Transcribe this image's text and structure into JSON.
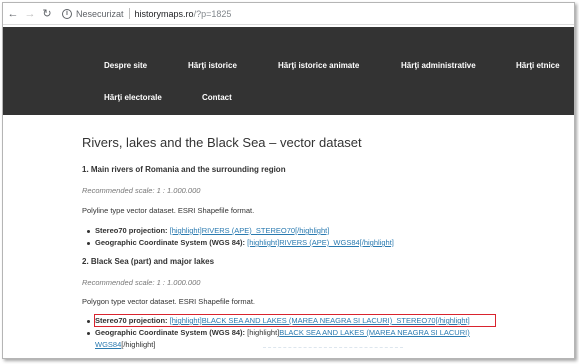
{
  "browser": {
    "back_icon": "arrow-left",
    "forward_icon": "arrow-right",
    "reload_icon": "reload",
    "security_text": "Nesecurizat",
    "url_host": "historymaps.ro",
    "url_path": "/?p=1825"
  },
  "nav": {
    "items": [
      {
        "label": "Despre site"
      },
      {
        "label": "Hărţi istorice"
      },
      {
        "label": "Hărţi istorice animate"
      },
      {
        "label": "Hărţi administrative"
      },
      {
        "label": "Hărţi etnice"
      },
      {
        "label": "Hărţi electorale"
      },
      {
        "label": "Contact"
      }
    ]
  },
  "article": {
    "title": "Rivers, lakes and the Black Sea – vector dataset",
    "sections": [
      {
        "heading": "1. Main rivers of Romania and the surrounding region",
        "scale": "Recommended scale: 1 : 1.000.000",
        "description": "Polyline type vector dataset. ESRI Shapefile format.",
        "items": [
          {
            "label": "Stereo70 projection:",
            "link": "[highlight]RIVERS (APE)_STEREO70[/highlight]"
          },
          {
            "label": "Geographic Coordinate System (WGS 84):",
            "link": "[highlight]RIVERS (APE)_WGS84[/highlight]"
          }
        ]
      },
      {
        "heading": "2. Black Sea (part) and major lakes",
        "scale": "Recommended scale: 1 : 1.000.000",
        "description": "Polygon type vector dataset. ESRI Shapefile format.",
        "items": [
          {
            "label": "Stereo70 projection:",
            "link": "[highlight]BLACK SEA AND LAKES (MAREA NEAGRA SI LACURI)_STEREO70[/highlight]"
          },
          {
            "label": "Geographic Coordinate System (WGS 84):",
            "prefix": "[highlight]",
            "link": "BLACK SEA AND LAKES (MAREA NEAGRA SI LACURI)",
            "link_cont": "WGS84",
            "suffix": "[/highlight]"
          }
        ]
      }
    ]
  },
  "colors": {
    "navbar": "#333333",
    "link": "#2a7ab0",
    "highlight_border": "#d9232e"
  }
}
